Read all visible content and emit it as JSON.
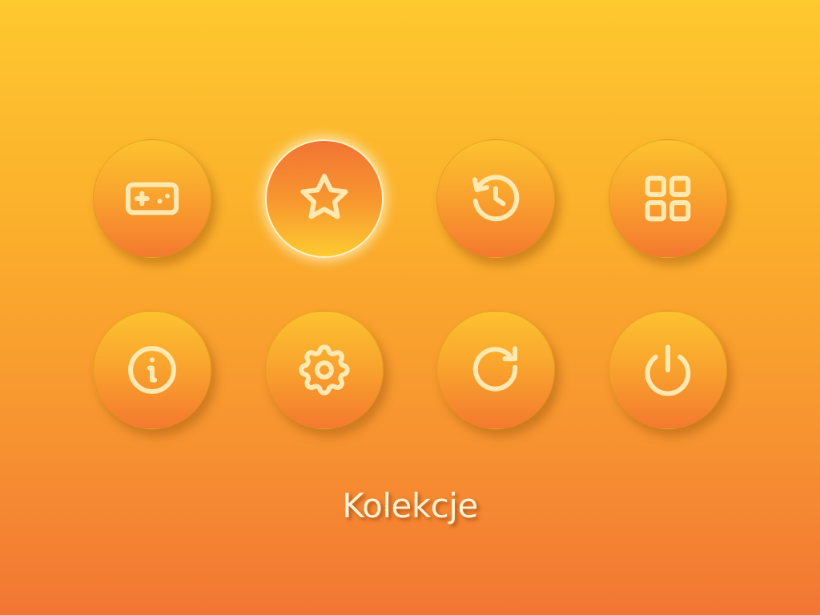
{
  "menu": {
    "items": [
      {
        "id": "games",
        "icon": "gamepad-icon",
        "selected": false
      },
      {
        "id": "favorites",
        "icon": "star-icon",
        "selected": true
      },
      {
        "id": "history",
        "icon": "history-icon",
        "selected": false
      },
      {
        "id": "collections",
        "icon": "grid-icon",
        "selected": false
      },
      {
        "id": "info",
        "icon": "info-icon",
        "selected": false
      },
      {
        "id": "settings",
        "icon": "gear-icon",
        "selected": false
      },
      {
        "id": "refresh",
        "icon": "refresh-icon",
        "selected": false
      },
      {
        "id": "power",
        "icon": "power-icon",
        "selected": false
      }
    ]
  },
  "caption": {
    "text": "Kolekcje"
  },
  "colors": {
    "background_top": "#fec82f",
    "background_bottom": "#f27634",
    "icon_stroke": "#ffe9b0",
    "selected_ring": "#fff2c8",
    "caption_text": "#fff1d2"
  }
}
